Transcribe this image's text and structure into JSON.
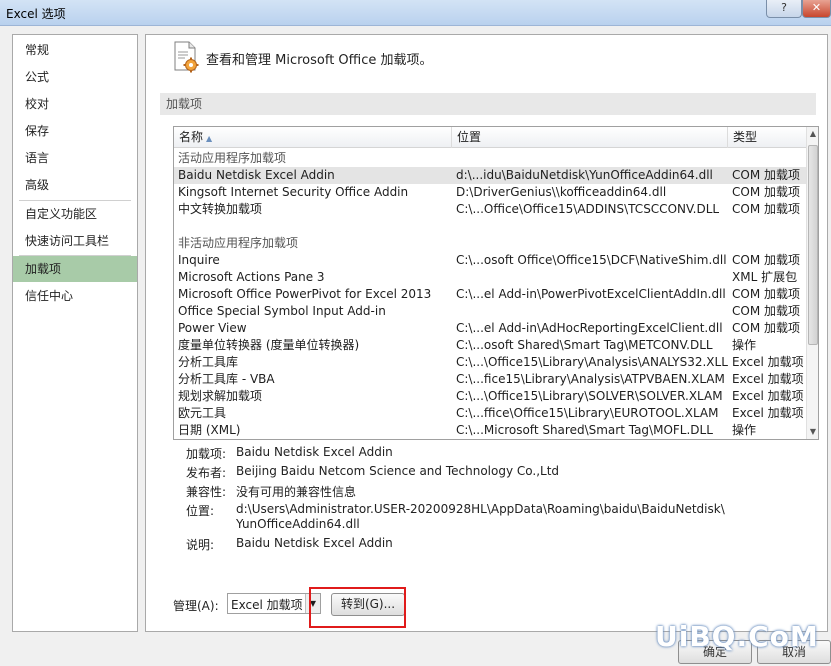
{
  "window": {
    "title": "Excel 选项",
    "help_label": "?",
    "close_label": "✕"
  },
  "nav": {
    "items": [
      {
        "label": "常规"
      },
      {
        "label": "公式"
      },
      {
        "label": "校对"
      },
      {
        "label": "保存"
      },
      {
        "label": "语言"
      },
      {
        "label": "高级"
      },
      {
        "label": "自定义功能区"
      },
      {
        "label": "快速访问工具栏"
      },
      {
        "label": "加载项",
        "selected": true
      },
      {
        "label": "信任中心"
      }
    ]
  },
  "header": {
    "text": "查看和管理 Microsoft Office 加载项。",
    "icon": "addin-gear-icon"
  },
  "section": {
    "title": "加载项"
  },
  "list": {
    "columns": {
      "name": "名称",
      "location": "位置",
      "type": "类型"
    },
    "active_group": "活动应用程序加载项",
    "active_rows": [
      {
        "name": "Baidu Netdisk Excel Addin",
        "location": "d:\\...idu\\BaiduNetdisk\\YunOfficeAddin64.dll",
        "type": "COM 加载项",
        "selected": true
      },
      {
        "name": "Kingsoft Internet Security Office Addin",
        "location": "D:\\DriverGenius\\\\kofficeaddin64.dll",
        "type": "COM 加载项"
      },
      {
        "name": "中文转换加载项",
        "location": "C:\\...Office\\Office15\\ADDINS\\TCSCCONV.DLL",
        "type": "COM 加载项"
      }
    ],
    "inactive_group": "非活动应用程序加载项",
    "inactive_rows": [
      {
        "name": "Inquire",
        "location": "C:\\...osoft Office\\Office15\\DCF\\NativeShim.dll",
        "type": "COM 加载项"
      },
      {
        "name": "Microsoft Actions Pane 3",
        "location": "",
        "type": "XML 扩展包"
      },
      {
        "name": "Microsoft Office PowerPivot for Excel 2013",
        "location": "C:\\...el Add-in\\PowerPivotExcelClientAddIn.dll",
        "type": "COM 加载项"
      },
      {
        "name": "Office Special Symbol Input Add-in",
        "location": "",
        "type": "COM 加载项"
      },
      {
        "name": "Power View",
        "location": "C:\\...el Add-in\\AdHocReportingExcelClient.dll",
        "type": "COM 加载项"
      },
      {
        "name": "度量单位转换器 (度量单位转换器)",
        "location": "C:\\...osoft Shared\\Smart Tag\\METCONV.DLL",
        "type": "操作"
      },
      {
        "name": "分析工具库",
        "location": "C:\\...\\Office15\\Library\\Analysis\\ANALYS32.XLL",
        "type": "Excel 加载项"
      },
      {
        "name": "分析工具库 - VBA",
        "location": "C:\\...fice15\\Library\\Analysis\\ATPVBAEN.XLAM",
        "type": "Excel 加载项"
      },
      {
        "name": "规划求解加载项",
        "location": "C:\\...\\Office15\\Library\\SOLVER\\SOLVER.XLAM",
        "type": "Excel 加载项"
      },
      {
        "name": "欧元工具",
        "location": "C:\\...ffice\\Office15\\Library\\EUROTOOL.XLAM",
        "type": "Excel 加载项"
      },
      {
        "name": "日期 (XML)",
        "location": "C:\\...Microsoft Shared\\Smart Tag\\MOFL.DLL",
        "type": "操作"
      }
    ]
  },
  "details": {
    "addin_label": "加载项:",
    "addin_value": "Baidu Netdisk Excel Addin",
    "publisher_label": "发布者:",
    "publisher_value": "Beijing Baidu Netcom Science and Technology Co.,Ltd",
    "compat_label": "兼容性:",
    "compat_value": "没有可用的兼容性信息",
    "location_label": "位置:",
    "location_line1": "d:\\Users\\Administrator.USER-20200928HL\\AppData\\Roaming\\baidu\\BaiduNetdisk\\",
    "location_line2": "YunOfficeAddin64.dll",
    "desc_label": "说明:",
    "desc_value": "Baidu Netdisk Excel Addin"
  },
  "manage": {
    "label": "管理(A):",
    "selected": "Excel 加载项",
    "go_label": "转到(G)..."
  },
  "footer": {
    "ok_label": "确定",
    "cancel_label": "取消"
  },
  "watermark": "UiBQ.CoM"
}
